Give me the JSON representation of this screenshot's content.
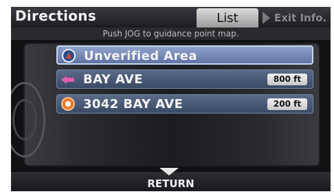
{
  "header": {
    "title": "Directions",
    "tabs": {
      "list_label": "List",
      "exit_label": "Exit Info."
    },
    "hint": "Push JOG to guidance point map."
  },
  "list": {
    "items": [
      {
        "icon": "unverified-area-icon",
        "label": "Unverified Area",
        "distance": "",
        "selected": true
      },
      {
        "icon": "turn-left-icon",
        "label": "BAY AVE",
        "distance": "800 ft",
        "selected": false
      },
      {
        "icon": "destination-icon",
        "label": "3042 BAY AVE",
        "distance": "200 ft",
        "selected": false
      }
    ]
  },
  "footer": {
    "return_label": "RETURN"
  },
  "colors": {
    "row_selected": "#8ea2cc",
    "row_normal": "#5a6a88",
    "turn_arrow": "#e05da8",
    "destination": "#e87a2a"
  }
}
